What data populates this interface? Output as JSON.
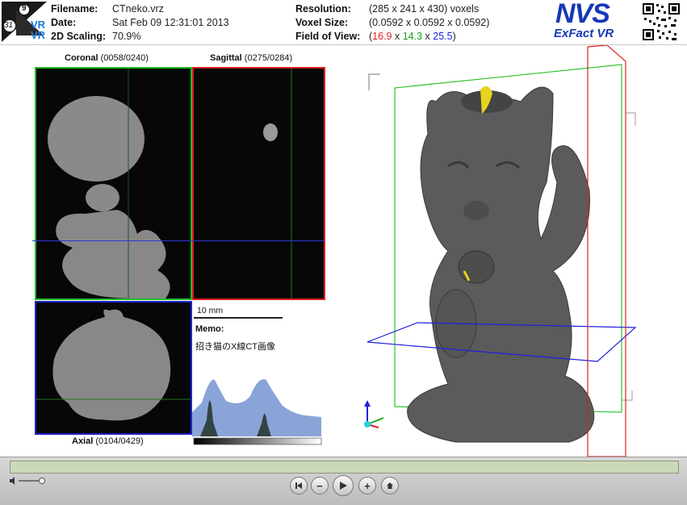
{
  "header": {
    "badge": {
      "top_number": "9",
      "side_number": "31",
      "vr_top": "VR",
      "vr_bottom": "VR"
    },
    "filename_label": "Filename:",
    "filename_value": "CTneko.vrz",
    "date_label": "Date:",
    "date_value": "Sat Feb 09 12:31:01 2013",
    "scaling_label": "2D Scaling:",
    "scaling_value": "70.9%",
    "resolution_label": "Resolution:",
    "resolution_value": "(285 x 241 x 430) voxels",
    "voxel_label": "Voxel Size:",
    "voxel_value": "(0.0592 x 0.0592 x 0.0592)",
    "fov_label": "Field of View:",
    "fov": {
      "open": "(",
      "x": "16.9",
      "sep1": " x ",
      "y": "14.3",
      "sep2": " x ",
      "z": "25.5",
      "close": ")"
    },
    "brand": {
      "line1": "NVS",
      "line2": "ExFact VR"
    }
  },
  "views": {
    "coronal": {
      "name": "Coronal",
      "index": "(0058/0240)"
    },
    "sagittal": {
      "name": "Sagittal",
      "index": "(0275/0284)"
    },
    "axial": {
      "name": "Axial",
      "index": "(0104/0429)"
    }
  },
  "scale_bar": {
    "label": "10 mm"
  },
  "memo": {
    "label": "Memo:",
    "text": "招き猫のX線CT画像"
  },
  "colors": {
    "fov_x": "#e02020",
    "fov_y": "#1a9a1a",
    "fov_z": "#2020e0",
    "coronal_border": "#22bb22",
    "sagittal_border": "#dd2020",
    "axial_border": "#2222cc"
  },
  "controls": {
    "volume_icon": "speaker-icon",
    "buttons": [
      "skip-back-icon",
      "minus-icon",
      "play-icon",
      "plus-icon",
      "home-icon"
    ],
    "minus": "−",
    "plus": "+"
  }
}
